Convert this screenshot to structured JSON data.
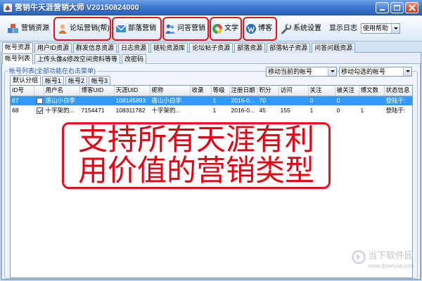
{
  "window": {
    "title": "营销牛天涯营销大师 V20150824000",
    "app_icon": "app-logo-icon",
    "controls": [
      "minimize-icon",
      "maximize-icon",
      "close-icon"
    ]
  },
  "toolbar": {
    "items": [
      {
        "label": "营销资源",
        "icon": "resources-icon"
      },
      {
        "label": "论坛营销(帮)",
        "icon": "forum-user-icon"
      },
      {
        "label": "部落营销",
        "icon": "envelope-icon"
      },
      {
        "label": "问答营销",
        "icon": "qa-users-icon"
      },
      {
        "label": "文学",
        "icon": "literature-icon"
      },
      {
        "label": "博客",
        "icon": "blog-icon"
      },
      {
        "label": "系统设置",
        "icon": "wrench-icon"
      }
    ],
    "show_log_label": "显示日志",
    "help_select_value": "使用帮助"
  },
  "main_tabs": [
    "帐号资源",
    "用户ID资源",
    "群发信息资源",
    "日志资源",
    "链轮资源库",
    "论坛帖子资源",
    "部落资源",
    "部落帖子资源",
    "问答问题资源"
  ],
  "sub_tabs": [
    "帐号列表",
    "上传头像&修改空间资料等等",
    "改密码"
  ],
  "account_list": {
    "group_label": "帐号列表(全部功能在右击菜单)",
    "move_current_select": "移动当前的帐号",
    "move_checked_select": "移动勾选的帐号",
    "group_tabs": [
      "默认分组",
      "帐号1",
      "帐号2",
      "帐号3"
    ],
    "columns": {
      "id": "ID号",
      "username": "用户名",
      "blog_uid": "博客UID",
      "tianya_uid": "天涯UID",
      "nickname": "昵称",
      "indexed": "收录",
      "level": "等级",
      "reg_date": "注册日期",
      "points": "积分",
      "visits": "访问",
      "following": "关注",
      "followers": "被关注",
      "posts": "博文数",
      "status": "状态信息"
    },
    "rows": [
      {
        "id": "67",
        "checked": false,
        "username": "唐山小白李",
        "blog_uid": "",
        "tianya_uid": "108145893",
        "nickname": "唐山小白李",
        "indexed": "",
        "level": "1",
        "reg_date": "2016-0...",
        "points": "70",
        "visits": "",
        "following": "0",
        "followers": "0",
        "posts": "",
        "status": "登陆于:"
      },
      {
        "id": "68",
        "checked": true,
        "username": "十字架的...",
        "blog_uid": "7154471",
        "tianya_uid": "108311782",
        "nickname": "十字架的...",
        "indexed": "",
        "level": "1",
        "reg_date": "2016-0...",
        "points": "45",
        "visits": "155",
        "following": "1",
        "followers": "0",
        "posts": "1",
        "status": "登陆于:"
      }
    ]
  },
  "overlay_caption": {
    "line1": "支持所有天涯有利",
    "line2": "用价值的营销类型"
  },
  "watermark": {
    "name": "当下软件园",
    "url": "www.downxia.com"
  },
  "colors": {
    "title_bar": "#3f78cf",
    "selected_row": "#3399ff",
    "annotation_red": "#e3141b",
    "caption_red": "#e60012"
  }
}
